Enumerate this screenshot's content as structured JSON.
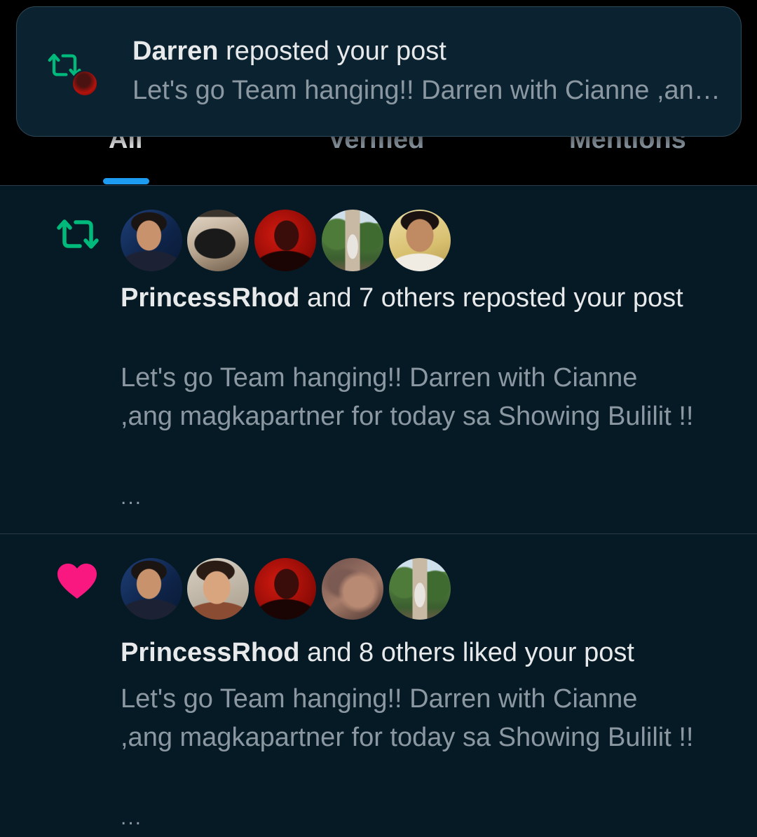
{
  "tabs": [
    {
      "label": "All",
      "active": true
    },
    {
      "label": "Verified",
      "active": false
    },
    {
      "label": "Mentions",
      "active": false
    }
  ],
  "toast": {
    "actor": "Darren",
    "action": "reposted your post",
    "snippet": "Let's go Team hanging!! Darren with Cianne ,ang magkapartner for today sa Showing Bulilit !!",
    "icon": "repost-icon",
    "icon_color": "#00ba7c"
  },
  "notifications": [
    {
      "type": "repost",
      "icon": "repost-icon",
      "icon_color": "#00ba7c",
      "actor": "PrincessRhod",
      "action": "and 7 others reposted your post",
      "snippet": "Let's go Team hanging!! Darren with Cianne ,ang magkapartner for today sa Showing Bulilit !!",
      "more": "...",
      "avatar_count": 5
    },
    {
      "type": "like",
      "icon": "heart-icon",
      "icon_color": "#f91880",
      "actor": "PrincessRhod",
      "action": "and 8 others liked your post",
      "snippet": "Let's go Team hanging!! Darren with Cianne ,ang magkapartner for today sa Showing Bulilit !!",
      "more": "...",
      "avatar_count": 5
    }
  ],
  "colors": {
    "background": "#061a25",
    "accent": "#1d9bf0",
    "repost_green": "#00ba7c",
    "like_pink": "#f91880"
  }
}
